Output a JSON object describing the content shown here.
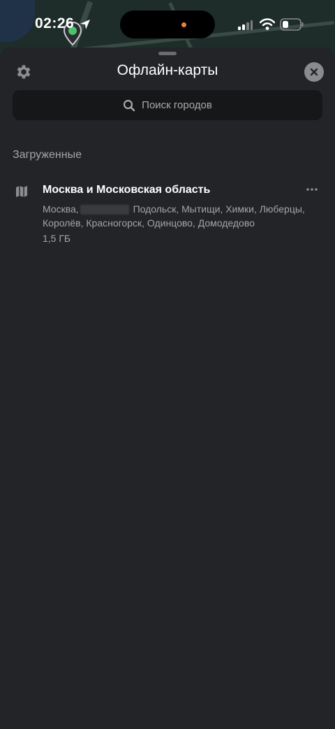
{
  "status_bar": {
    "time": "02:26"
  },
  "header": {
    "title": "Офлайн-карты"
  },
  "search": {
    "placeholder": "Поиск городов"
  },
  "downloaded": {
    "section_title": "Загруженные",
    "items": [
      {
        "title": "Москва и Московская область",
        "cities_start": "Москва,",
        "cities_rest": "Подольск, Мытищи, Химки, Люберцы, Королёв, Красногорск, Одинцово, Домодедово",
        "size": "1,5 ГБ"
      }
    ]
  },
  "colors": {
    "sheet_background": "#232428",
    "search_background": "#161719",
    "secondary_text": "#a4a5a8",
    "recording_dot": "#e8833a"
  },
  "icons": [
    "location-arrow-icon",
    "map-pin-icon",
    "signal-icon",
    "wifi-icon",
    "battery-icon",
    "gear-icon",
    "close-icon",
    "search-icon",
    "map-icon",
    "more-icon"
  ]
}
